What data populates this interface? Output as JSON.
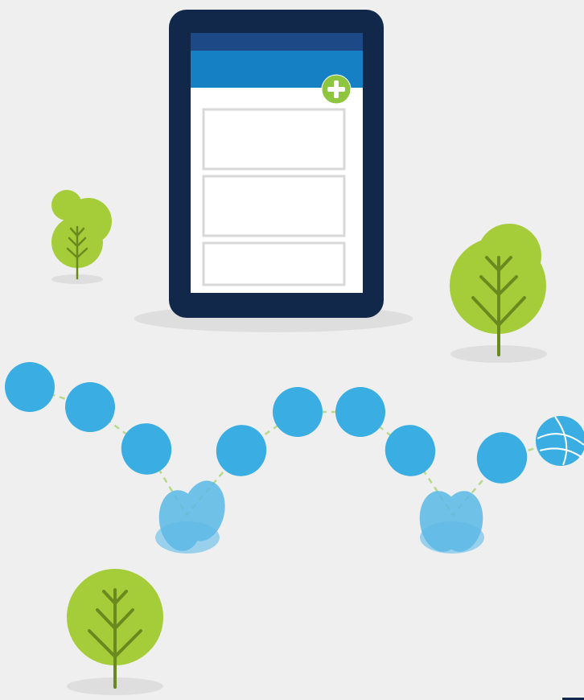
{
  "scene": {
    "description_label": "",
    "tablet": {
      "frame_icon": "tablet-icon",
      "fab_icon": "add-icon",
      "list_card_count_visible": 3
    },
    "trees": [
      "tree-icon",
      "tree-icon",
      "tree-icon",
      "tree-icon"
    ],
    "ball_icon": "bouncing-ball-icon"
  },
  "colors": {
    "background": "#efefef",
    "tablet_frame": "#11284a",
    "app_statusbar": "#1d4a86",
    "app_toolbar": "#1580c4",
    "screen": "#ffffff",
    "card_border": "#d8d8d8",
    "fab": "#8dc53e",
    "tree_leaf": "#a5cd39",
    "tree_trunk": "#6a8a1f",
    "ball": "#3aaee2",
    "ball_squash": "#7cc7ec",
    "trail": "#b7d98a",
    "shadow": "#dedede"
  }
}
